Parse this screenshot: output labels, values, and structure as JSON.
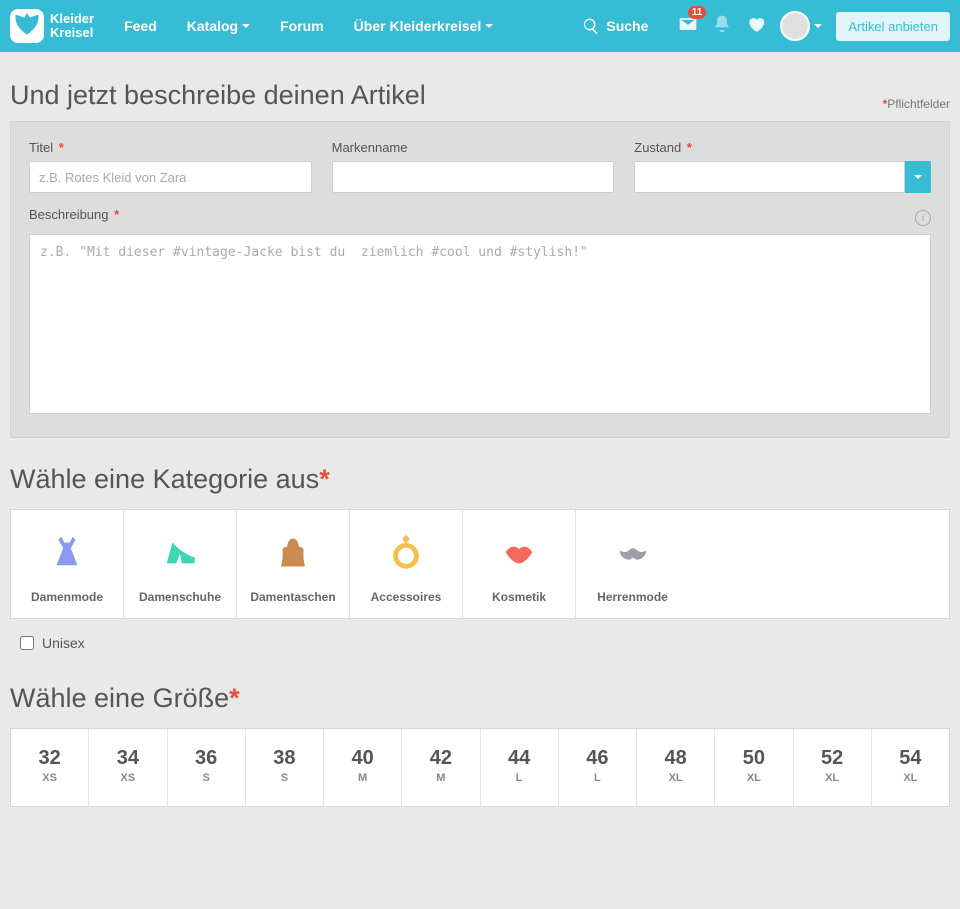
{
  "header": {
    "brand_line1": "Kleider",
    "brand_line2": "Kreisel",
    "nav": {
      "feed": "Feed",
      "catalog": "Katalog",
      "forum": "Forum",
      "about": "Über Kleiderkreisel"
    },
    "search": "Suche",
    "notif_count": "11",
    "offer_btn": "Artikel anbieten"
  },
  "describe": {
    "title": "Und jetzt beschreibe deinen Artikel",
    "required_note": "Pflichtfelder",
    "title_label": "Titel",
    "title_placeholder": "z.B. Rotes Kleid von Zara",
    "brand_label": "Markenname",
    "condition_label": "Zustand",
    "desc_label": "Beschreibung",
    "desc_placeholder": "z.B. \"Mit dieser #vintage-Jacke bist du  ziemlich #cool und #stylish!\""
  },
  "category": {
    "title": "Wähle eine Kategorie aus",
    "items": [
      {
        "label": "Damenmode"
      },
      {
        "label": "Damenschuhe"
      },
      {
        "label": "Damentaschen"
      },
      {
        "label": "Accessoires"
      },
      {
        "label": "Kosmetik"
      },
      {
        "label": "Herrenmode"
      }
    ],
    "unisex": "Unisex"
  },
  "size": {
    "title": "Wähle eine Größe",
    "items": [
      {
        "num": "32",
        "lbl": "XS"
      },
      {
        "num": "34",
        "lbl": "XS"
      },
      {
        "num": "36",
        "lbl": "S"
      },
      {
        "num": "38",
        "lbl": "S"
      },
      {
        "num": "40",
        "lbl": "M"
      },
      {
        "num": "42",
        "lbl": "M"
      },
      {
        "num": "44",
        "lbl": "L"
      },
      {
        "num": "46",
        "lbl": "L"
      },
      {
        "num": "48",
        "lbl": "XL"
      },
      {
        "num": "50",
        "lbl": "XL"
      },
      {
        "num": "52",
        "lbl": "XL"
      },
      {
        "num": "54",
        "lbl": "XL"
      }
    ]
  }
}
